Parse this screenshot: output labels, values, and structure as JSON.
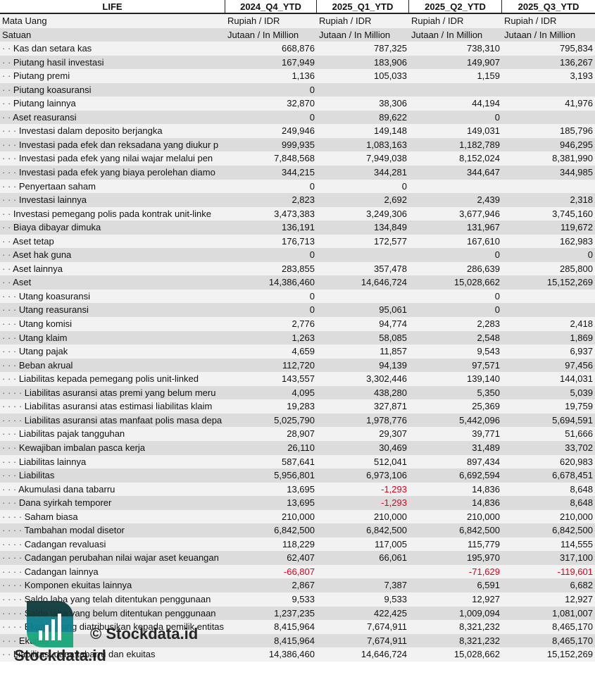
{
  "header": {
    "title": "LIFE",
    "periods": [
      "2024_Q4_YTD",
      "2025_Q1_YTD",
      "2025_Q2_YTD",
      "2025_Q3_YTD"
    ]
  },
  "meta_rows": [
    {
      "label": "Mata Uang",
      "values": [
        "Rupiah / IDR",
        "Rupiah / IDR",
        "Rupiah / IDR",
        "Rupiah / IDR"
      ]
    },
    {
      "label": "Satuan",
      "values": [
        "Jutaan / In Million",
        "Jutaan / In Million",
        "Jutaan / In Million",
        "Jutaan / In Million"
      ]
    }
  ],
  "rows": [
    {
      "level": 2,
      "label": "Kas dan setara kas",
      "values": [
        "668,876",
        "787,325",
        "738,310",
        "795,834"
      ]
    },
    {
      "level": 2,
      "label": "Piutang hasil investasi",
      "values": [
        "167,949",
        "183,906",
        "149,907",
        "136,267"
      ]
    },
    {
      "level": 2,
      "label": "Piutang premi",
      "values": [
        "1,136",
        "105,033",
        "1,159",
        "3,193"
      ]
    },
    {
      "level": 2,
      "label": "Piutang koasuransi",
      "values": [
        "0",
        "",
        "",
        ""
      ]
    },
    {
      "level": 2,
      "label": "Piutang lainnya",
      "values": [
        "32,870",
        "38,306",
        "44,194",
        "41,976"
      ]
    },
    {
      "level": 2,
      "label": "Aset reasuransi",
      "values": [
        "0",
        "89,622",
        "0",
        ""
      ]
    },
    {
      "level": 3,
      "label": "Investasi dalam deposito berjangka",
      "values": [
        "249,946",
        "149,148",
        "149,031",
        "185,796"
      ]
    },
    {
      "level": 3,
      "label": "Investasi pada efek dan reksadana yang diukur p",
      "values": [
        "999,935",
        "1,083,163",
        "1,182,789",
        "946,295"
      ]
    },
    {
      "level": 3,
      "label": "Investasi pada efek yang nilai wajar melalui pen",
      "values": [
        "7,848,568",
        "7,949,038",
        "8,152,024",
        "8,381,990"
      ]
    },
    {
      "level": 3,
      "label": "Investasi pada efek yang biaya perolehan diamo",
      "values": [
        "344,215",
        "344,281",
        "344,647",
        "344,985"
      ]
    },
    {
      "level": 3,
      "label": "Penyertaan saham",
      "values": [
        "0",
        "0",
        "",
        ""
      ]
    },
    {
      "level": 3,
      "label": "Investasi lainnya",
      "values": [
        "2,823",
        "2,692",
        "2,439",
        "2,318"
      ]
    },
    {
      "level": 2,
      "label": "Investasi pemegang polis pada kontrak unit-linke",
      "values": [
        "3,473,383",
        "3,249,306",
        "3,677,946",
        "3,745,160"
      ]
    },
    {
      "level": 2,
      "label": "Biaya dibayar dimuka",
      "values": [
        "136,191",
        "134,849",
        "131,967",
        "119,672"
      ]
    },
    {
      "level": 2,
      "label": "Aset tetap",
      "values": [
        "176,713",
        "172,577",
        "167,610",
        "162,983"
      ]
    },
    {
      "level": 2,
      "label": "Aset hak guna",
      "values": [
        "0",
        "",
        "0",
        "0"
      ]
    },
    {
      "level": 2,
      "label": "Aset lainnya",
      "values": [
        "283,855",
        "357,478",
        "286,639",
        "285,800"
      ]
    },
    {
      "level": 2,
      "label": "Aset",
      "values": [
        "14,386,460",
        "14,646,724",
        "15,028,662",
        "15,152,269"
      ]
    },
    {
      "level": 3,
      "label": "Utang koasuransi",
      "values": [
        "0",
        "",
        "0",
        ""
      ]
    },
    {
      "level": 3,
      "label": "Utang reasuransi",
      "values": [
        "0",
        "95,061",
        "0",
        ""
      ]
    },
    {
      "level": 3,
      "label": "Utang komisi",
      "values": [
        "2,776",
        "94,774",
        "2,283",
        "2,418"
      ]
    },
    {
      "level": 3,
      "label": "Utang klaim",
      "values": [
        "1,263",
        "58,085",
        "2,548",
        "1,869"
      ]
    },
    {
      "level": 3,
      "label": "Utang pajak",
      "values": [
        "4,659",
        "11,857",
        "9,543",
        "6,937"
      ]
    },
    {
      "level": 3,
      "label": "Beban akrual",
      "values": [
        "112,720",
        "94,139",
        "97,571",
        "97,456"
      ]
    },
    {
      "level": 3,
      "label": "Liabilitas kepada pemegang polis unit-linked",
      "values": [
        "143,557",
        "3,302,446",
        "139,140",
        "144,031"
      ]
    },
    {
      "level": 4,
      "label": "Liabilitas asuransi atas premi yang belum meru",
      "values": [
        "4,095",
        "438,280",
        "5,350",
        "5,039"
      ]
    },
    {
      "level": 4,
      "label": "Liabilitas asuransi atas estimasi liabilitas klaim",
      "values": [
        "19,283",
        "327,871",
        "25,369",
        "19,759"
      ]
    },
    {
      "level": 4,
      "label": "Liabilitas asuransi atas manfaat polis masa depa",
      "values": [
        "5,025,790",
        "1,978,776",
        "5,442,096",
        "5,694,591"
      ]
    },
    {
      "level": 3,
      "label": "Liabilitas pajak tangguhan",
      "values": [
        "28,907",
        "29,307",
        "39,771",
        "51,666"
      ]
    },
    {
      "level": 3,
      "label": "Kewajiban imbalan pasca kerja",
      "values": [
        "26,110",
        "30,469",
        "31,489",
        "33,702"
      ]
    },
    {
      "level": 3,
      "label": "Liabilitas lainnya",
      "values": [
        "587,641",
        "512,041",
        "897,434",
        "620,983"
      ]
    },
    {
      "level": 3,
      "label": "Liabilitas",
      "values": [
        "5,956,801",
        "6,973,106",
        "6,692,594",
        "6,678,451"
      ]
    },
    {
      "level": 3,
      "label": "Akumulasi dana tabarru",
      "values": [
        "13,695",
        "-1,293",
        "14,836",
        "8,648"
      ]
    },
    {
      "level": 3,
      "label": "Dana syirkah temporer",
      "values": [
        "13,695",
        "-1,293",
        "14,836",
        "8,648"
      ]
    },
    {
      "level": 4,
      "label": "Saham biasa",
      "values": [
        "210,000",
        "210,000",
        "210,000",
        "210,000"
      ]
    },
    {
      "level": 4,
      "label": "Tambahan modal disetor",
      "values": [
        "6,842,500",
        "6,842,500",
        "6,842,500",
        "6,842,500"
      ]
    },
    {
      "level": 4,
      "label": "Cadangan revaluasi",
      "values": [
        "118,229",
        "117,005",
        "115,779",
        "114,555"
      ]
    },
    {
      "level": 4,
      "label": "Cadangan perubahan nilai wajar aset keuangan",
      "values": [
        "62,407",
        "66,061",
        "195,970",
        "317,100"
      ]
    },
    {
      "level": 4,
      "label": "Cadangan lainnya",
      "values": [
        "-66,807",
        "",
        "-71,629",
        "-119,601"
      ]
    },
    {
      "level": 4,
      "label": "Komponen ekuitas lainnya",
      "values": [
        "2,867",
        "7,387",
        "6,591",
        "6,682"
      ]
    },
    {
      "level": 4,
      "label": "Saldo laba yang telah ditentukan penggunaan",
      "values": [
        "9,533",
        "9,533",
        "12,927",
        "12,927"
      ]
    },
    {
      "level": 4,
      "label": "Saldo laba yang belum ditentukan penggunaan",
      "values": [
        "1,237,235",
        "422,425",
        "1,009,094",
        "1,081,007"
      ]
    },
    {
      "level": 4,
      "label": "Ekuitas yang diatribusikan kepada pemilik entitas",
      "values": [
        "8,415,964",
        "7,674,911",
        "8,321,232",
        "8,465,170"
      ]
    },
    {
      "level": 3,
      "label": "Ekuitas",
      "values": [
        "8,415,964",
        "7,674,911",
        "8,321,232",
        "8,465,170"
      ]
    },
    {
      "level": 2,
      "label": "Liabilitas, dana tabarru dan ekuitas",
      "values": [
        "14,386,460",
        "14,646,724",
        "15,028,662",
        "15,152,269"
      ]
    }
  ],
  "colors": {
    "negative": "#e0001b",
    "row_light": "#f2f2f2",
    "row_dark": "#dcdcdc"
  },
  "watermark": {
    "copyright": "© Stockdata.id",
    "brand": "Stockdata.id"
  }
}
